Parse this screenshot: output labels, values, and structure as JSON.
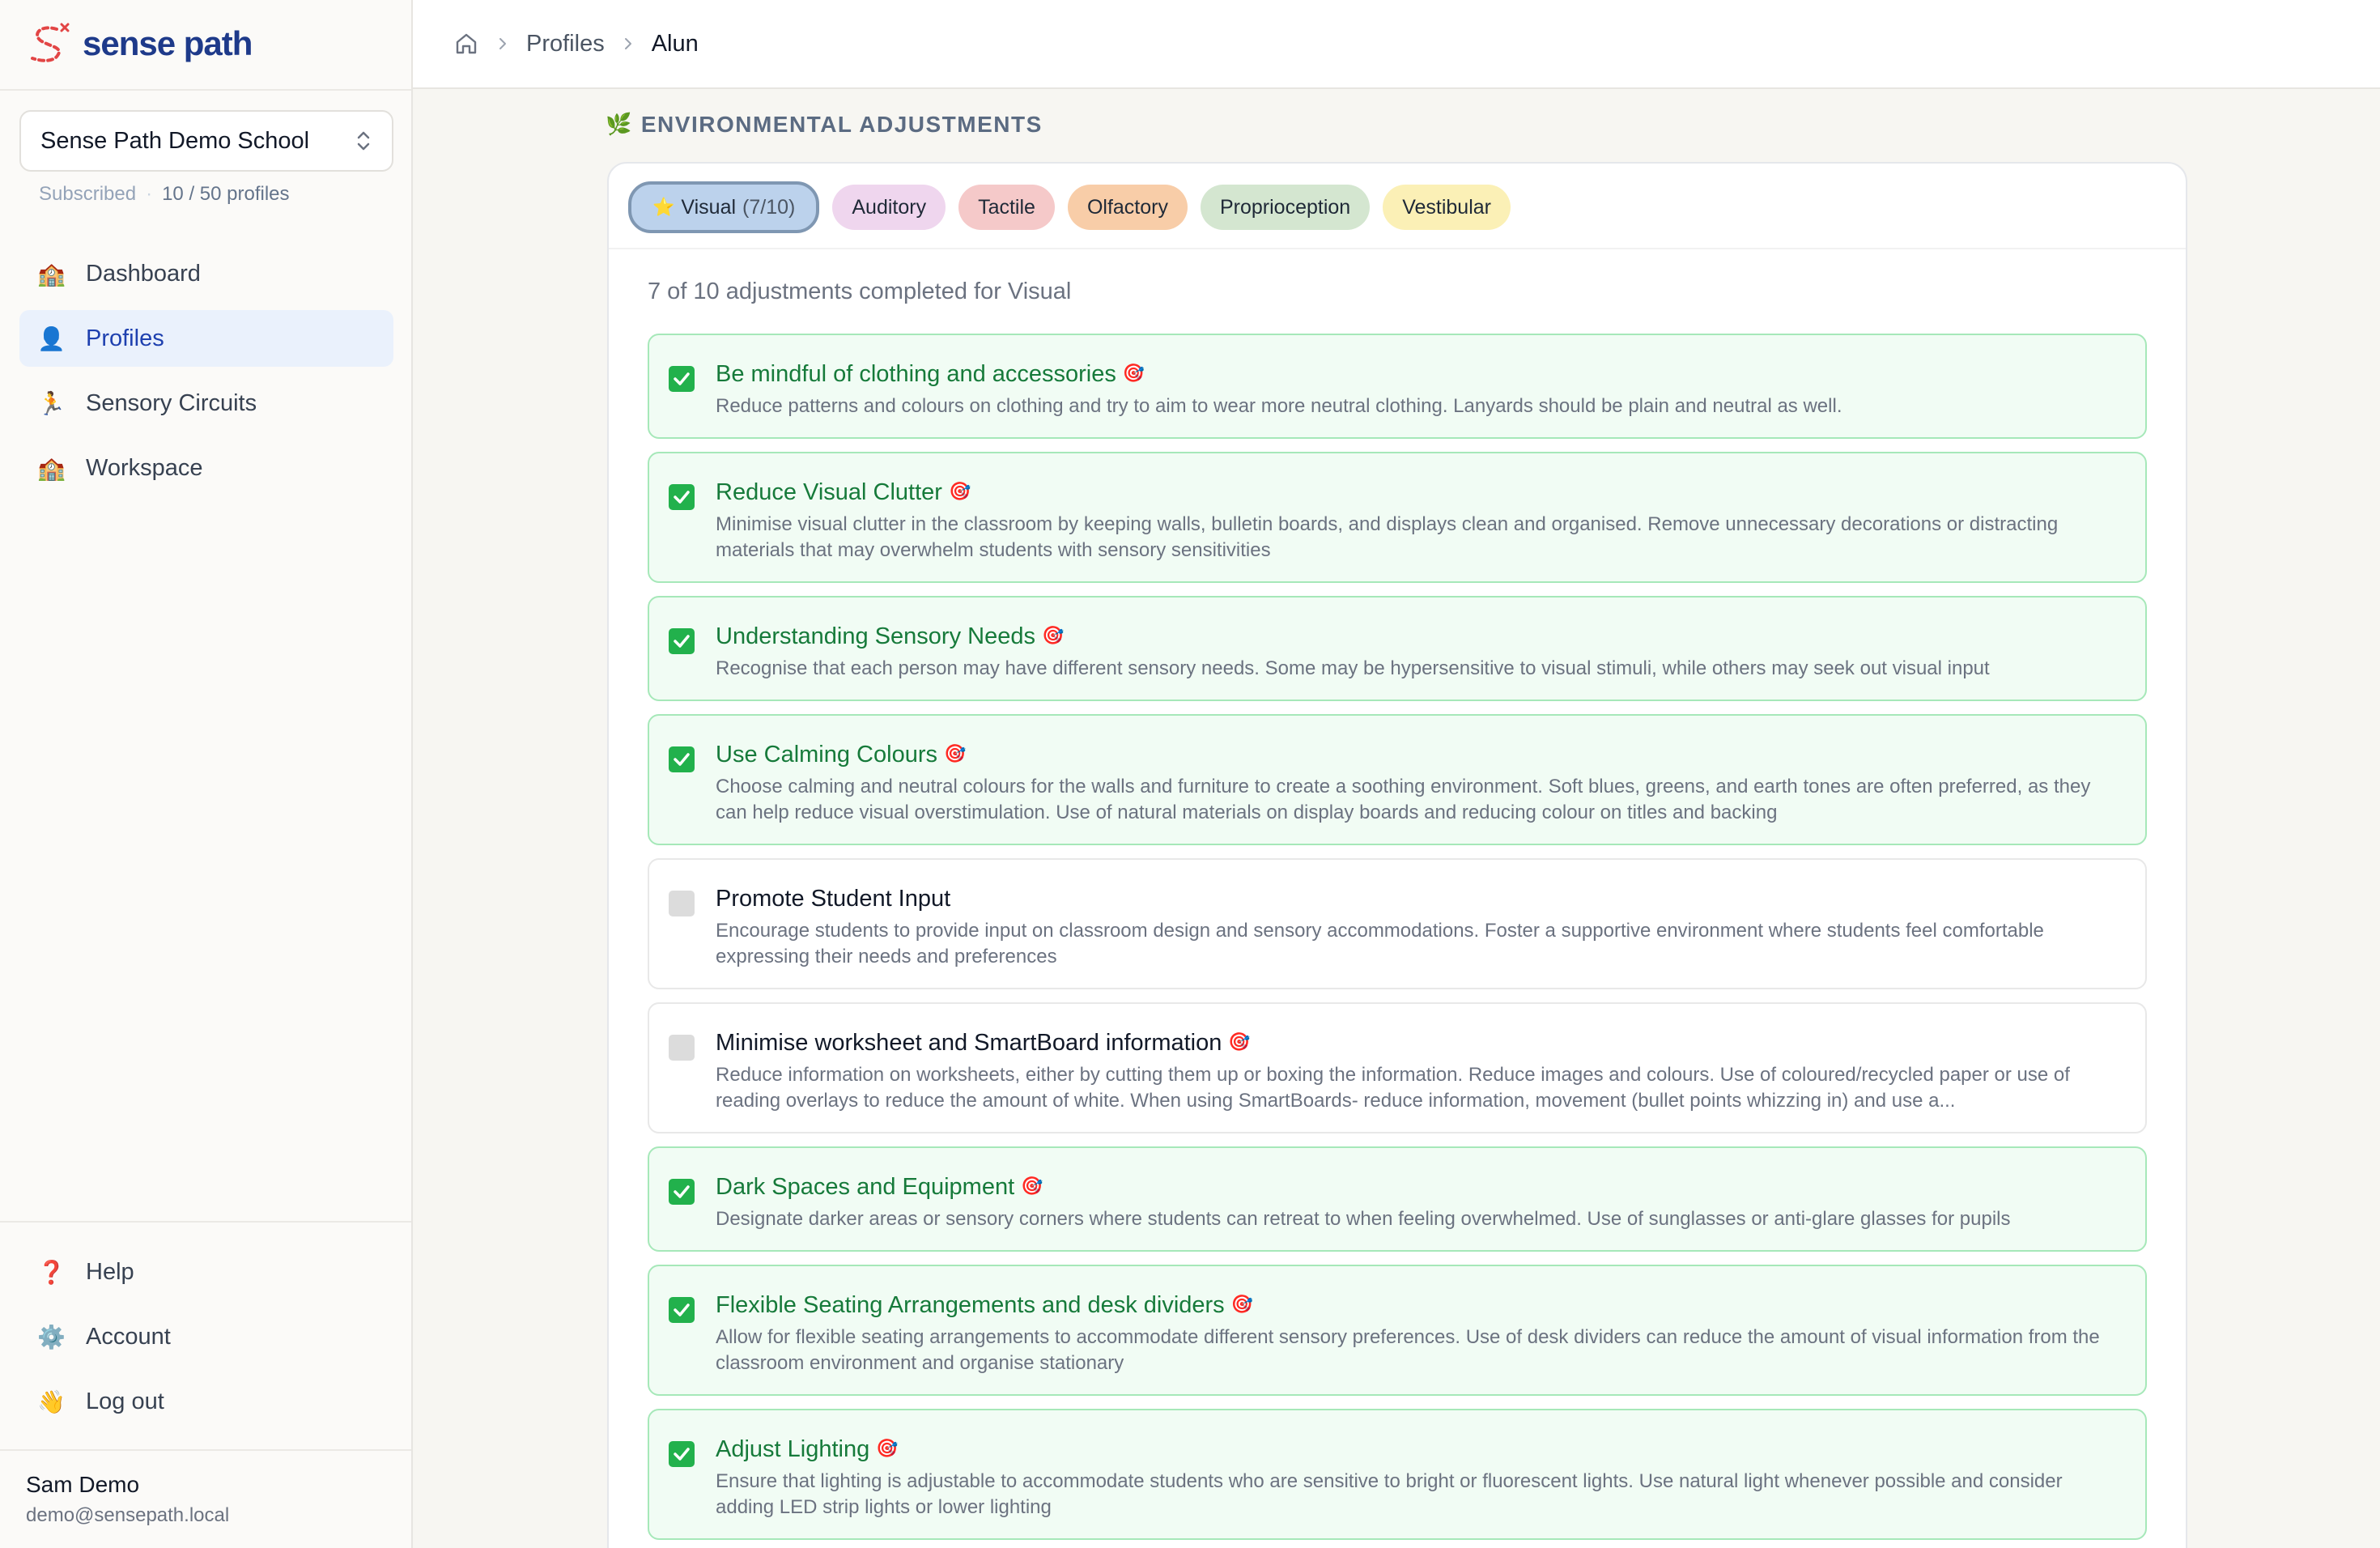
{
  "app": {
    "logo_text": "sense path",
    "logo_icon": "sense-path-logo"
  },
  "school": {
    "name": "Sense Path Demo School",
    "status": "Subscribed",
    "profile_count": "10 / 50 profiles"
  },
  "nav": {
    "items": [
      {
        "label": "Dashboard",
        "icon": "🏫"
      },
      {
        "label": "Profiles",
        "icon": "👤"
      },
      {
        "label": "Sensory Circuits",
        "icon": "🏃"
      },
      {
        "label": "Workspace",
        "icon": "🏫"
      }
    ],
    "bottom": [
      {
        "label": "Help",
        "icon": "❓"
      },
      {
        "label": "Account",
        "icon": "⚙️"
      },
      {
        "label": "Log out",
        "icon": "👋"
      }
    ]
  },
  "user": {
    "name": "Sam Demo",
    "email": "demo@sensepath.local"
  },
  "breadcrumb": {
    "items": [
      "Profiles",
      "Alun"
    ]
  },
  "section": {
    "icon": "🌿",
    "title": "ENVIRONMENTAL ADJUSTMENTS"
  },
  "tabs": [
    {
      "label": "Visual",
      "count": "(7/10)",
      "icon": "⭐",
      "active": true
    },
    {
      "label": "Auditory"
    },
    {
      "label": "Tactile"
    },
    {
      "label": "Olfactory"
    },
    {
      "label": "Proprioception"
    },
    {
      "label": "Vestibular"
    }
  ],
  "summary": "7 of 10 adjustments completed for Visual",
  "target_icon": "🎯",
  "adjustments": [
    {
      "title": "Be mindful of clothing and accessories",
      "done": true,
      "targeted": true,
      "desc": "Reduce patterns and colours on clothing and try to aim to wear more neutral clothing. Lanyards should be plain and neutral as well."
    },
    {
      "title": "Reduce Visual Clutter",
      "done": true,
      "targeted": true,
      "desc": "Minimise visual clutter in the classroom by keeping walls, bulletin boards, and displays clean and organised. Remove unnecessary decorations or distracting materials that may overwhelm students with sensory sensitivities"
    },
    {
      "title": "Understanding Sensory Needs",
      "done": true,
      "targeted": true,
      "desc": "Recognise that each person may have different sensory needs. Some may be hypersensitive to visual stimuli, while others may seek out visual input"
    },
    {
      "title": "Use Calming Colours",
      "done": true,
      "targeted": true,
      "desc": "Choose calming and neutral colours for the walls and furniture to create a soothing environment. Soft blues, greens, and earth tones are often preferred, as they can help reduce visual overstimulation. Use of natural materials on display boards and reducing colour on titles and backing"
    },
    {
      "title": "Promote Student Input",
      "done": false,
      "targeted": false,
      "desc": "Encourage students to provide input on classroom design and sensory accommodations. Foster a supportive environment where students feel comfortable expressing their needs and preferences"
    },
    {
      "title": "Minimise worksheet and SmartBoard information",
      "done": false,
      "targeted": true,
      "desc": "Reduce information on worksheets, either by cutting them up or boxing the information. Reduce images and colours. Use of coloured/recycled paper or use of reading overlays to reduce the amount of white. When using SmartBoards- reduce information, movement (bullet points whizzing in) and use a..."
    },
    {
      "title": "Dark Spaces and Equipment",
      "done": true,
      "targeted": true,
      "desc": "Designate darker areas or sensory corners where students can retreat to when feeling overwhelmed. Use of sunglasses or anti-glare glasses for pupils"
    },
    {
      "title": "Flexible Seating Arrangements and desk dividers",
      "done": true,
      "targeted": true,
      "desc": "Allow for flexible seating arrangements to accommodate different sensory preferences. Use of desk dividers can reduce the amount of visual information from the classroom environment and organise stationary"
    },
    {
      "title": "Adjust Lighting",
      "done": true,
      "targeted": true,
      "desc": "Ensure that lighting is adjustable to accommodate students who are sensitive to bright or fluorescent lights. Use natural light whenever possible and consider adding LED strip lights or lower lighting"
    }
  ]
}
